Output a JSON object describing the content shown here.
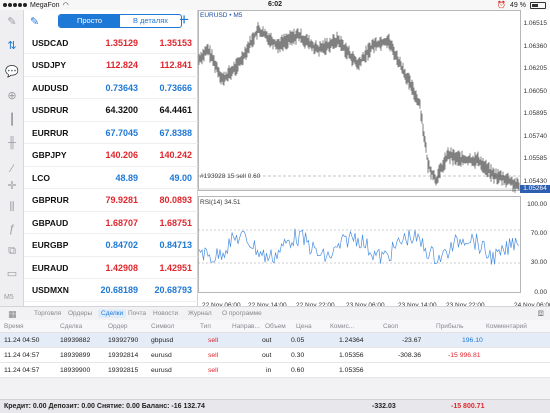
{
  "status_bar": {
    "carrier": "MegaFon",
    "time": "6:02",
    "battery": "49 %"
  },
  "quotes": {
    "segment_simple": "Просто",
    "segment_detailed": "В деталях",
    "rows": [
      {
        "symbol": "USDCAD",
        "bid": "1.35129",
        "ask": "1.35153",
        "color": "red"
      },
      {
        "symbol": "USDJPY",
        "bid": "112.824",
        "ask": "112.841",
        "color": "red"
      },
      {
        "symbol": "AUDUSD",
        "bid": "0.73643",
        "ask": "0.73666",
        "color": "blue"
      },
      {
        "symbol": "USDRUR",
        "bid": "64.3200",
        "ask": "64.4461",
        "color": "black"
      },
      {
        "symbol": "EURRUR",
        "bid": "67.7045",
        "ask": "67.8388",
        "color": "blue"
      },
      {
        "symbol": "GBPJPY",
        "bid": "140.206",
        "ask": "140.242",
        "color": "red"
      },
      {
        "symbol": "LCO",
        "bid": "48.89",
        "ask": "49.00",
        "color": "blue"
      },
      {
        "symbol": "GBPRUR",
        "bid": "79.9281",
        "ask": "80.0893",
        "color": "red"
      },
      {
        "symbol": "GBPAUD",
        "bid": "1.68707",
        "ask": "1.68751",
        "color": "red"
      },
      {
        "symbol": "EURGBP",
        "bid": "0.84702",
        "ask": "0.84713",
        "color": "blue"
      },
      {
        "symbol": "EURAUD",
        "bid": "1.42908",
        "ask": "1.42951",
        "color": "red"
      },
      {
        "symbol": "USDMXN",
        "bid": "20.68189",
        "ask": "20.68793",
        "color": "blue"
      }
    ]
  },
  "toolbar": {
    "timeframe_label": "M5"
  },
  "chart": {
    "title": "EURUSD • M5",
    "trade_label": "#193928 15 sell 0.60",
    "indicator_title": "RSI(14) 34.51",
    "current_price": "1.05264",
    "price_ticks": [
      "1.06515",
      "1.06360",
      "1.06205",
      "1.06050",
      "1.05895",
      "1.05740",
      "1.05585",
      "1.05430"
    ],
    "rsi_ticks": [
      "100.00",
      "70.00",
      "30.00",
      "0.00"
    ],
    "time_ticks": [
      "22 Nov 06:00",
      "22 Nov 14:00",
      "22 Nov 22:00",
      "23 Nov 06:00",
      "23 Nov 14:00",
      "23 Nov 22:00",
      "24 Nov 06:00"
    ],
    "colors": {
      "price": "#4a4a4a",
      "rsi": "#4b8fe0",
      "price_box": "#2c5fb0"
    }
  },
  "tabs": [
    "Торговля",
    "Ордеры",
    "Сделки",
    "Почта",
    "Новости",
    "Журнал",
    "О программе"
  ],
  "active_tab": "Сделки",
  "table": {
    "headers": [
      "Время",
      "Сделка",
      "Ордер",
      "Символ",
      "Тип",
      "Направ...",
      "Объем",
      "Цена",
      "Комис...",
      "Своп",
      "Прибыль",
      "Комментарий"
    ],
    "rows": [
      {
        "time": "11.24 04:50",
        "deal": "18939882",
        "order": "19392790",
        "symbol": "gbpusd",
        "type": "sell",
        "dir": "out",
        "volume": "0.05",
        "price": "1.24364",
        "commission": "",
        "swap": "-23.67",
        "profit": "196.10",
        "profit_color": "blue"
      },
      {
        "time": "11.24 04:57",
        "deal": "18939899",
        "order": "19392814",
        "symbol": "eurusd",
        "type": "sell",
        "dir": "out",
        "volume": "0.30",
        "price": "1.05356",
        "commission": "",
        "swap": "-308.36",
        "profit": "-15 996.81",
        "profit_color": "red"
      },
      {
        "time": "11.24 04:57",
        "deal": "18939900",
        "order": "19392815",
        "symbol": "eurusd",
        "type": "sell",
        "dir": "in",
        "volume": "0.60",
        "price": "1.05356",
        "commission": "",
        "swap": "",
        "profit": "",
        "profit_color": "black"
      }
    ]
  },
  "footer": {
    "summary": "Кредит: 0.00 Депозит: 0.00 Снятие: 0.00 Баланс: -16 132.74",
    "total_swap": "-332.03",
    "total_profit": "-15 800.71"
  }
}
